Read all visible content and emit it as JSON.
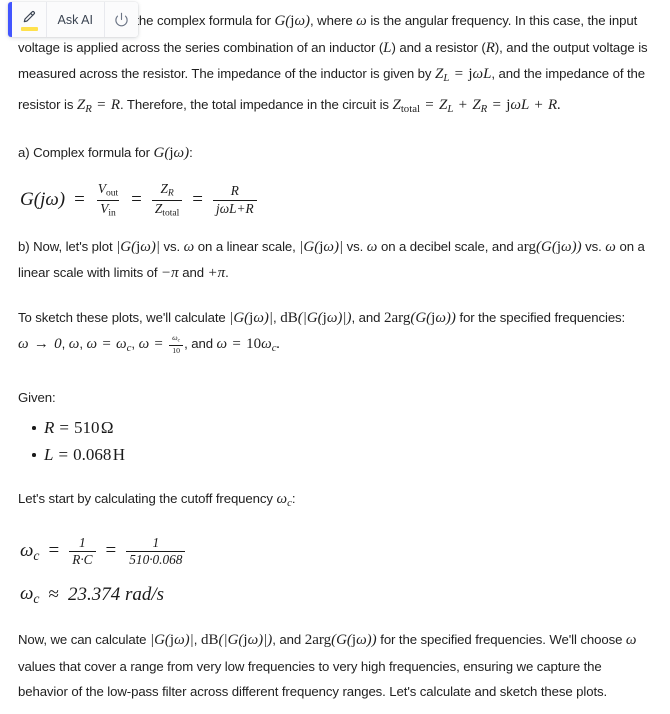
{
  "toolbar": {
    "highlight_icon": "highlighter-pen-icon",
    "ask_ai_label": "Ask AI",
    "power_icon": "power-icon",
    "accent_color": "#4255ff",
    "highlight_color": "#ffe14d"
  },
  "content": {
    "intro": {
      "line1_visible": "lem, let's first derive the complex formula for",
      "g_jw": "G(jω)",
      "after_g": ", where",
      "omega": "ω",
      "rest": "is the angular frequency. In this case, the input voltage is applied across the series combination of an inductor (L) and a resistor (R), and the output voltage is measured across the resistor. The impedance of the inductor is given by Z_L = jωL, and the impedance of the resistor is Z_R = R. Therefore, the total impedance in the circuit is Z_total = Z_L + Z_R = jωL + R."
    },
    "section_a": {
      "heading_prefix": "a) Complex formula for",
      "heading_math": "G(jω)",
      "heading_suffix": ":",
      "equation": "G(jω) = V_out/V_in = Z_R/Z_total = R/(jωL+R)"
    },
    "section_b": {
      "text": "b) Now, let's plot |G(jω)| vs. ω on a linear scale, |G(jω)| vs. ω on a decibel scale, and arg(G(jω)) vs. ω on a linear scale with limits of −π and +π.",
      "sketch_text": "To sketch these plots, we'll calculate |G(jω)|, dB(|G(jω)|), and 2arg(G(jω)) for the specified frequencies: ω → 0, ω, ω = ω_c, ω = ω_c/10, and ω = 10ω_c."
    },
    "given": {
      "label": "Given:",
      "items": [
        {
          "symbol": "R",
          "value": "510",
          "unit": "Ω"
        },
        {
          "symbol": "L",
          "value": "0.068",
          "unit": "H"
        }
      ]
    },
    "cutoff": {
      "intro_prefix": "Let's start by calculating the cutoff frequency",
      "intro_symbol": "ωc",
      "intro_suffix": ":",
      "formula": "ω_c = 1/(R·C) = 1/(510·0.068)",
      "denominator_symbolic_num": "1",
      "denominator_symbolic_den": "R·C",
      "denominator_numeric_num": "1",
      "denominator_numeric_den": "510·0.068",
      "result_symbol": "ωc",
      "result_approx": "≈",
      "result_value": "23.374 rad/s"
    },
    "closing": {
      "text": "Now, we can calculate |G(jω)|, dB(|G(jω)|), and 2arg(G(jω)) for the specified frequencies. We'll choose ω values that cover a range from very low frequencies to very high frequencies, ensuring we capture the behavior of the low-pass filter across different frequency ranges. Let's calculate and sketch these plots."
    }
  }
}
